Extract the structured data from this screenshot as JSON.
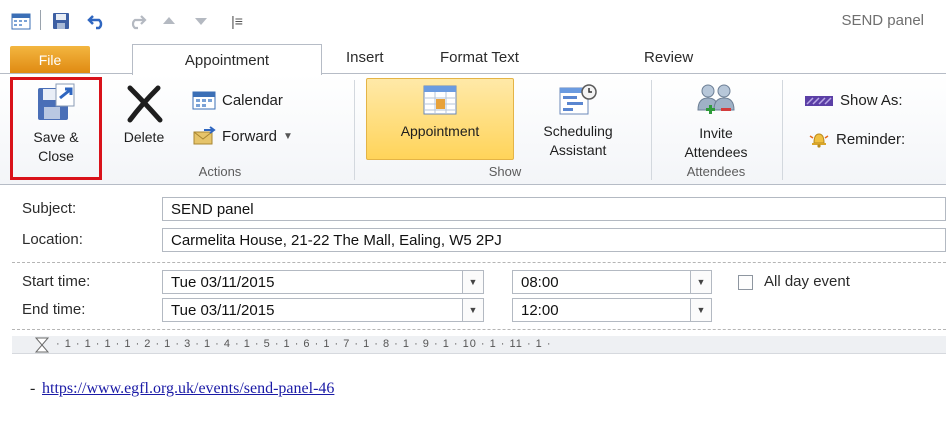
{
  "window": {
    "title": "SEND panel"
  },
  "quick_access": {
    "more_label": "|≡"
  },
  "tabs": {
    "file": "File",
    "items": [
      "Appointment",
      "Insert",
      "Format Text",
      "Review"
    ]
  },
  "ribbon": {
    "actions": {
      "group_label": "Actions",
      "save_close_line1": "Save &",
      "save_close_line2": "Close",
      "delete": "Delete",
      "calendar": "Calendar",
      "forward": "Forward"
    },
    "show": {
      "group_label": "Show",
      "appointment": "Appointment",
      "scheduling_line1": "Scheduling",
      "scheduling_line2": "Assistant"
    },
    "attendees": {
      "group_label": "Attendees",
      "invite_line1": "Invite",
      "invite_line2": "Attendees"
    },
    "options": {
      "show_as": "Show As:",
      "reminder": "Reminder:"
    }
  },
  "form": {
    "subject_label": "Subject:",
    "subject_value": "SEND panel",
    "location_label": "Location:",
    "location_value": "Carmelita House, 21-22 The Mall, Ealing, W5 2PJ",
    "start_label": "Start time:",
    "start_date": "Tue 03/11/2015",
    "start_time": "08:00",
    "all_day_label": "All day event",
    "end_label": "End time:",
    "end_date": "Tue 03/11/2015",
    "end_time": "12:00"
  },
  "ruler": {
    "text": "· 1 · 1 · 1 · 1 · 2 · 1 · 3 · 1 · 4 · 1 · 5 · 1 · 6 · 1 · 7 · 1 · 8 · 1 · 9 · 1 · 10 · 1 · 11 · 1 ·"
  },
  "body": {
    "bullet": "-",
    "link": "https://www.egfl.org.uk/events/send-panel-46"
  },
  "colors": {
    "file_tab": "#e08a12",
    "highlight_border": "#d9121a",
    "selected_button": "#ffd45a",
    "link": "#1a1aa6"
  }
}
